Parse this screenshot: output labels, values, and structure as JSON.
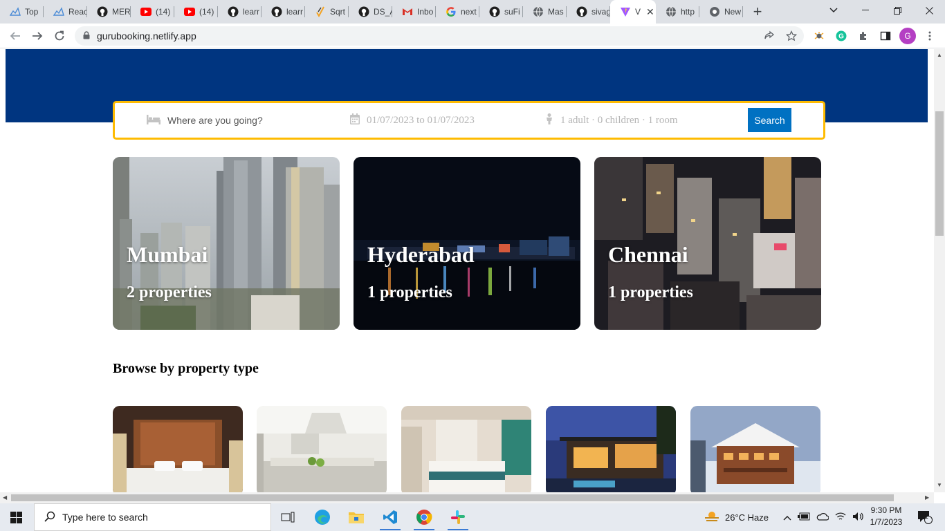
{
  "browser": {
    "tabs": [
      {
        "label": "Top",
        "icon": "chart-favicon",
        "color": "#4a8bd6"
      },
      {
        "label": "Reac",
        "icon": "chart-favicon",
        "color": "#4a8bd6"
      },
      {
        "label": "MER",
        "icon": "github-favicon",
        "color": "#1f1f1f"
      },
      {
        "label": "(14)",
        "icon": "youtube-favicon",
        "color": "#ff0000"
      },
      {
        "label": "(14)",
        "icon": "youtube-favicon",
        "color": "#ff0000"
      },
      {
        "label": "learr",
        "icon": "github-favicon",
        "color": "#1f1f1f"
      },
      {
        "label": "learr",
        "icon": "github-favicon",
        "color": "#1f1f1f"
      },
      {
        "label": "Sqrt",
        "icon": "sqrt-favicon",
        "color": "#f4a322"
      },
      {
        "label": "DS_A",
        "icon": "github-favicon",
        "color": "#1f1f1f"
      },
      {
        "label": "Inbo",
        "icon": "gmail-favicon",
        "color": "#d93025"
      },
      {
        "label": "next",
        "icon": "google-favicon",
        "color": "#4285f4"
      },
      {
        "label": "suFi",
        "icon": "github-favicon",
        "color": "#1f1f1f"
      },
      {
        "label": "Mas",
        "icon": "globe-favicon",
        "color": "#5f6368"
      },
      {
        "label": "sivag",
        "icon": "github-favicon",
        "color": "#1f1f1f"
      },
      {
        "label": "V",
        "icon": "vite-favicon",
        "color": "#a259ff",
        "active": true
      },
      {
        "label": "http",
        "icon": "globe-favicon",
        "color": "#5f6368"
      },
      {
        "label": "New",
        "icon": "chrome-favicon",
        "color": "#5f6368"
      }
    ],
    "url": "gurubooking.netlify.app",
    "profile_initial": "G"
  },
  "search": {
    "destination_placeholder": "Where are you going?",
    "dates": "01/07/2023 to 01/07/2023",
    "options": "1 adult · 0 children · 1 room",
    "button_label": "Search"
  },
  "featured": [
    {
      "city": "Mumbai",
      "properties": "2 properties"
    },
    {
      "city": "Hyderabad",
      "properties": "1 properties"
    },
    {
      "city": "Chennai",
      "properties": "1 properties"
    }
  ],
  "property_types_title": "Browse by property type",
  "colors": {
    "brand": "#003580",
    "search_border": "#febb02",
    "search_button": "#0071c2"
  },
  "taskbar": {
    "search_placeholder": "Type here to search",
    "weather": "26°C  Haze",
    "time": "9:30 PM",
    "date": "1/7/2023",
    "notifications": "1"
  }
}
